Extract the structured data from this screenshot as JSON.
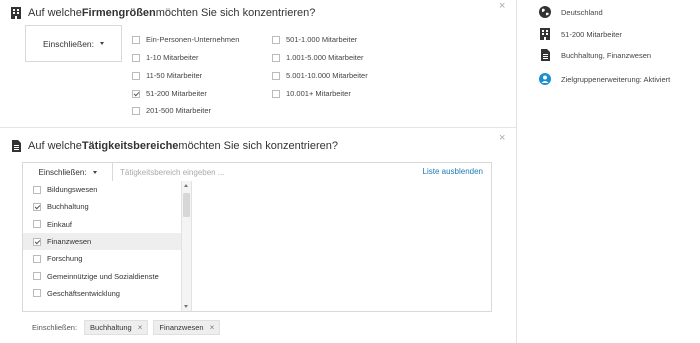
{
  "company_size": {
    "title_prefix": "Auf welche ",
    "title_bold": "Firmengrößen",
    "title_suffix": " möchten Sie sich konzentrieren?",
    "dropdown_label": "Einschließen:",
    "options": [
      {
        "label": "Ein-Personen-Unternehmen",
        "checked": false
      },
      {
        "label": "1-10 Mitarbeiter",
        "checked": false
      },
      {
        "label": "11-50 Mitarbeiter",
        "checked": false
      },
      {
        "label": "51-200 Mitarbeiter",
        "checked": true
      },
      {
        "label": "201-500 Mitarbeiter",
        "checked": false
      },
      {
        "label": "501-1.000 Mitarbeiter",
        "checked": false
      },
      {
        "label": "1.001-5.000 Mitarbeiter",
        "checked": false
      },
      {
        "label": "5.001-10.000 Mitarbeiter",
        "checked": false
      },
      {
        "label": "10.001+ Mitarbeiter",
        "checked": false
      }
    ]
  },
  "activity_areas": {
    "title_prefix": "Auf welche ",
    "title_bold": "Tätigkeitsbereiche",
    "title_suffix": " möchten Sie sich konzentrieren?",
    "dropdown_label": "Einschließen:",
    "search_placeholder": "Tätigkeitsbereich eingeben ...",
    "hide_list_label": "Liste ausblenden",
    "items": [
      {
        "label": "Bildungswesen",
        "checked": false,
        "highlight": false
      },
      {
        "label": "Buchhaltung",
        "checked": true,
        "highlight": false
      },
      {
        "label": "Einkauf",
        "checked": false,
        "highlight": false
      },
      {
        "label": "Finanzwesen",
        "checked": true,
        "highlight": true
      },
      {
        "label": "Forschung",
        "checked": false,
        "highlight": false
      },
      {
        "label": "Gemeinnützige und Sozialdienste",
        "checked": false,
        "highlight": false
      },
      {
        "label": "Geschäftsentwicklung",
        "checked": false,
        "highlight": false
      }
    ],
    "selected_label": "Einschließen:",
    "selected_tags": [
      "Buchhaltung",
      "Finanzwesen"
    ]
  },
  "close_glyph": "×",
  "summary": {
    "location": "Deutschland",
    "company_size": "51-200 Mitarbeiter",
    "activity_areas": "Buchhaltung, Finanzwesen",
    "audience_expansion": "Zielgruppenerweiterung: Aktiviert"
  },
  "colors": {
    "link": "#1a7bb3",
    "icon": "#333333",
    "expansion_icon": "#1a8fd0"
  }
}
